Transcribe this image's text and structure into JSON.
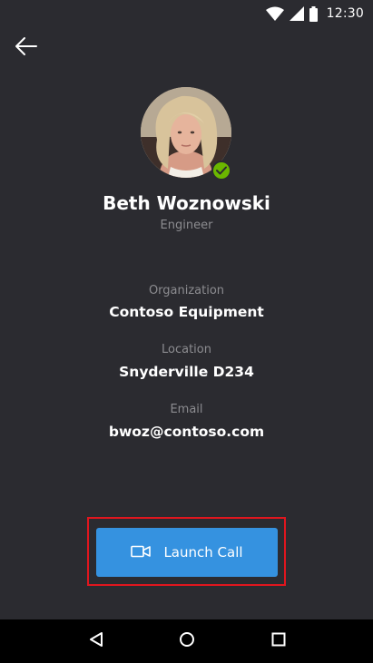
{
  "status_bar": {
    "time": "12:30",
    "icons": [
      "wifi-icon",
      "signal-icon",
      "battery-icon"
    ]
  },
  "header": {
    "back_icon": "back-arrow-icon"
  },
  "profile": {
    "name": "Beth Woznowski",
    "title": "Engineer",
    "presence": "available",
    "presence_color": "#6bb700"
  },
  "details": [
    {
      "label": "Organization",
      "value": "Contoso Equipment"
    },
    {
      "label": "Location",
      "value": "Snyderville D234"
    },
    {
      "label": "Email",
      "value": "bwoz@contoso.com"
    }
  ],
  "call_button": {
    "label": "Launch Call",
    "icon": "video-camera-icon",
    "color": "#3592e0",
    "highlight_color": "#e0161e"
  },
  "nav_bar": {
    "buttons": [
      "back-triangle-icon",
      "home-circle-icon",
      "recents-square-icon"
    ]
  }
}
